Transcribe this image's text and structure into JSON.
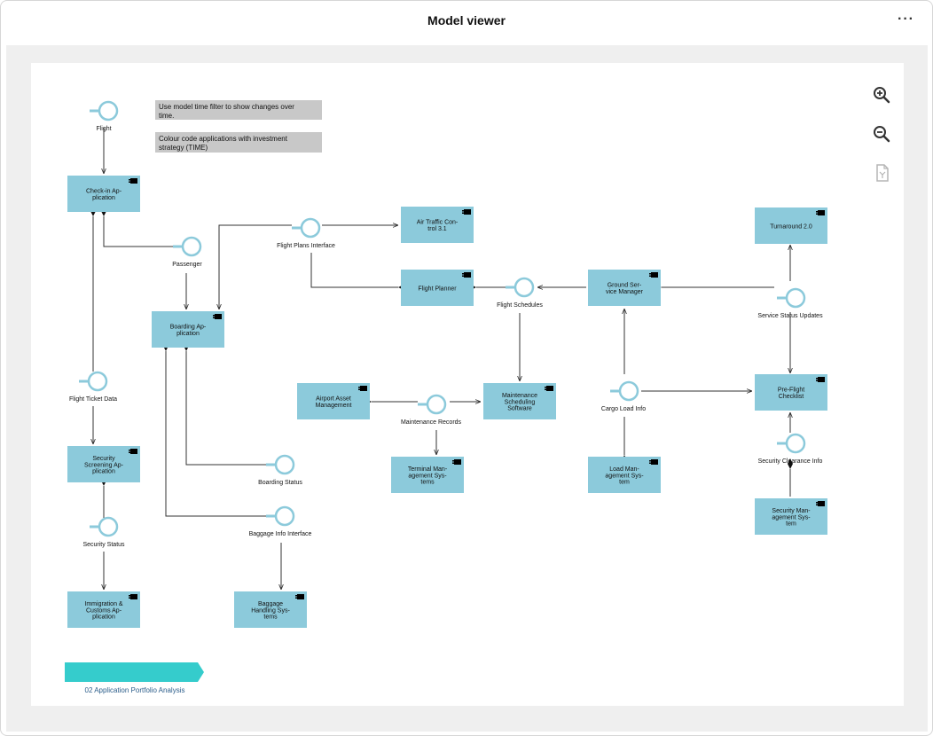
{
  "header": {
    "title": "Model viewer",
    "more_label": "···"
  },
  "notes": [
    "Use model time filter to show changes over time.",
    "Colour code applications with investment strategy (TIME)"
  ],
  "applications": [
    {
      "id": "checkin",
      "lines": [
        "Check-in Ap-",
        "plication"
      ]
    },
    {
      "id": "boarding",
      "lines": [
        "Boarding Ap-",
        "plication"
      ]
    },
    {
      "id": "security",
      "lines": [
        "Security",
        "Screening Ap-",
        "plication"
      ]
    },
    {
      "id": "immigration",
      "lines": [
        "Immigration &",
        "Customs Ap-",
        "plication"
      ]
    },
    {
      "id": "baggage",
      "lines": [
        "Baggage",
        "Handling Sys-",
        "tems"
      ]
    },
    {
      "id": "atc",
      "lines": [
        "Air Traffic Con-",
        "trol 3.1"
      ]
    },
    {
      "id": "planner",
      "lines": [
        "Flight Planner"
      ]
    },
    {
      "id": "airport",
      "lines": [
        "Airport Asset",
        "Management"
      ]
    },
    {
      "id": "maint",
      "lines": [
        "Maintenance",
        "Scheduling",
        "Software"
      ]
    },
    {
      "id": "terminal",
      "lines": [
        "Terminal Man-",
        "agement Sys-",
        "tems"
      ]
    },
    {
      "id": "ground",
      "lines": [
        "Ground Ser-",
        "vice Manager"
      ]
    },
    {
      "id": "load",
      "lines": [
        "Load Man-",
        "agement Sys-",
        "tem"
      ]
    },
    {
      "id": "turnaround",
      "lines": [
        "Turnaround 2.0"
      ]
    },
    {
      "id": "preflight",
      "lines": [
        "Pre-Flight",
        "Checklist"
      ]
    },
    {
      "id": "secmgmt",
      "lines": [
        "Security Man-",
        "agement Sys-",
        "tem"
      ]
    }
  ],
  "interfaces": [
    {
      "id": "flight",
      "label": "Flight"
    },
    {
      "id": "passenger",
      "label": "Passenger"
    },
    {
      "id": "ticket",
      "label": "Flight Ticket Data"
    },
    {
      "id": "secstatus",
      "label": "Security Status"
    },
    {
      "id": "boardstatus",
      "label": "Boarding Status"
    },
    {
      "id": "bagif",
      "label": "Baggage Info Interface"
    },
    {
      "id": "plans",
      "label": "Flight Plans Interface"
    },
    {
      "id": "schedules",
      "label": "Flight Schedules"
    },
    {
      "id": "records",
      "label": "Maintenance Records"
    },
    {
      "id": "cargo",
      "label": "Cargo Load Info"
    },
    {
      "id": "svcstatus",
      "label": "Service Status Updates"
    },
    {
      "id": "clearance",
      "label": "Security Clearance Info"
    }
  ],
  "view_tab": {
    "label": "02 Application Portfolio Analysis"
  },
  "colors": {
    "app_fill": "#8ccadb",
    "interface_stroke": "#8ccadb",
    "note_fill": "#c8c8c8",
    "tab_fill": "#35cccc",
    "tab_text": "#2b5d8a",
    "connector": "#333333"
  },
  "toolbar": [
    "zoom-in-icon",
    "zoom-out-icon",
    "fit-page-icon"
  ]
}
